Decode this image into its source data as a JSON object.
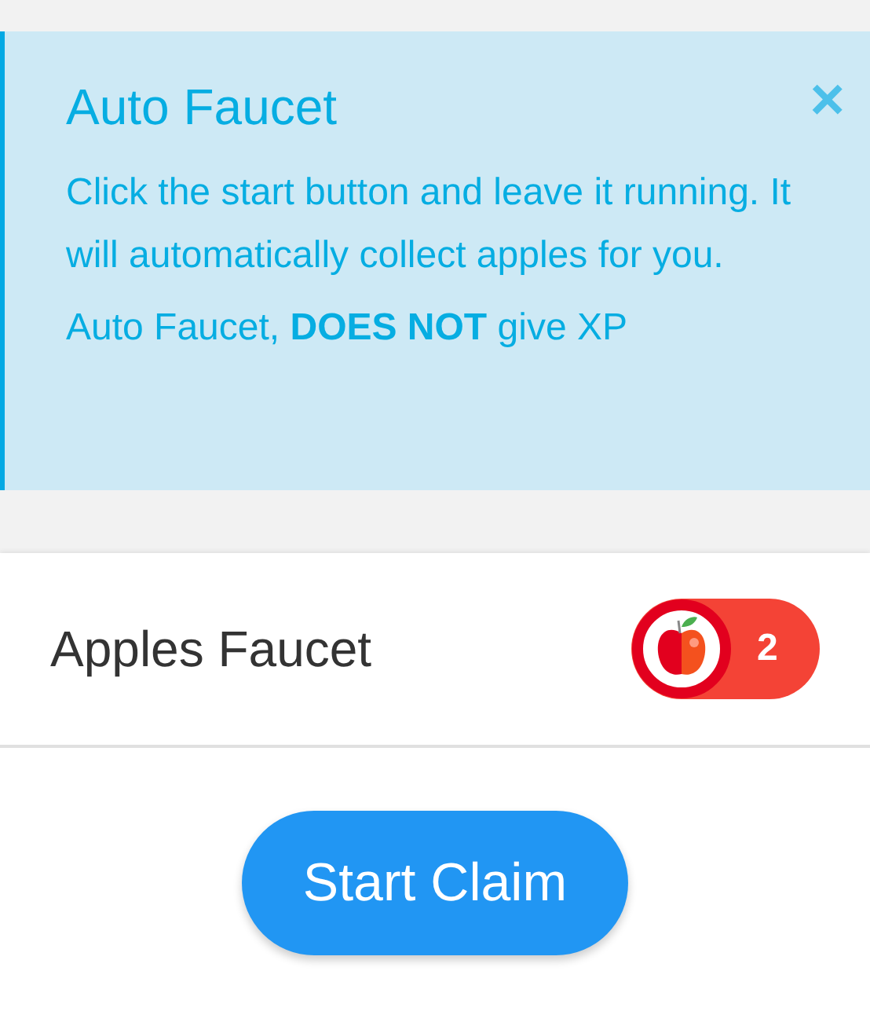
{
  "alert": {
    "title": "Auto Faucet",
    "close": "×",
    "message": "Click the start button and leave it running. It will automatically collect apples for you.",
    "note": "Auto Faucet, **DOES NOT** give XP"
  },
  "card": {
    "title": "Apples Faucet",
    "badge_count": "2",
    "button": "Start Claim"
  }
}
